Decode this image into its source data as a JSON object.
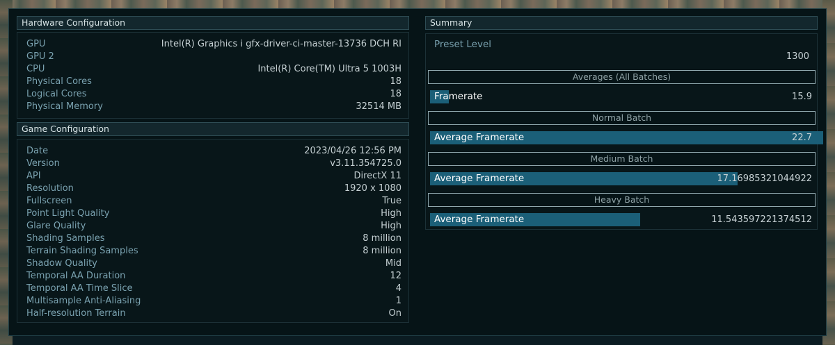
{
  "hardware": {
    "title": "Hardware Configuration",
    "rows": [
      {
        "label": "GPU",
        "value": "Intel(R) Graphics i gfx-driver-ci-master-13736 DCH RI"
      },
      {
        "label": "GPU 2",
        "value": ""
      },
      {
        "label": "CPU",
        "value": "Intel(R) Core(TM) Ultra 5 1003H"
      },
      {
        "label": "Physical Cores",
        "value": "18"
      },
      {
        "label": "Logical Cores",
        "value": "18"
      },
      {
        "label": "Physical Memory",
        "value": "32514 MB"
      }
    ]
  },
  "game": {
    "title": "Game Configuration",
    "rows": [
      {
        "label": "Date",
        "value": "2023/04/26 12:56 PM"
      },
      {
        "label": "Version",
        "value": "v3.11.354725.0"
      },
      {
        "label": "API",
        "value": "DirectX 11"
      },
      {
        "label": "Resolution",
        "value": "1920 x 1080"
      },
      {
        "label": "Fullscreen",
        "value": "True"
      },
      {
        "label": "Point Light Quality",
        "value": "High"
      },
      {
        "label": "Glare Quality",
        "value": "High"
      },
      {
        "label": "Shading Samples",
        "value": "8 million"
      },
      {
        "label": "Terrain Shading Samples",
        "value": "8 million"
      },
      {
        "label": "Shadow Quality",
        "value": "Mid"
      },
      {
        "label": "Temporal AA Duration",
        "value": "12"
      },
      {
        "label": "Temporal AA Time Slice",
        "value": "4"
      },
      {
        "label": "Multisample Anti-Aliasing",
        "value": "1"
      },
      {
        "label": "Half-resolution Terrain",
        "value": "On"
      }
    ]
  },
  "summary": {
    "title": "Summary",
    "preset_label": "Preset Level",
    "preset_value": "1300",
    "batches": [
      {
        "header": "Averages (All Batches)",
        "label": "Framerate",
        "value": "15.9",
        "fill_fraction": 0.047
      },
      {
        "header": "Normal Batch",
        "label": "Average Framerate",
        "value": "22.7",
        "fill_fraction": 1.0
      },
      {
        "header": "Medium Batch",
        "label": "Average Framerate",
        "value": "17.16985321044922",
        "fill_fraction": 0.783
      },
      {
        "header": "Heavy Batch",
        "label": "Average Framerate",
        "value": "11.543597221374512",
        "fill_fraction": 0.535
      }
    ]
  },
  "colors": {
    "bar_fill": "#1b5f78",
    "label_text": "#7aa2b0",
    "value_text": "#c4cfd2"
  }
}
